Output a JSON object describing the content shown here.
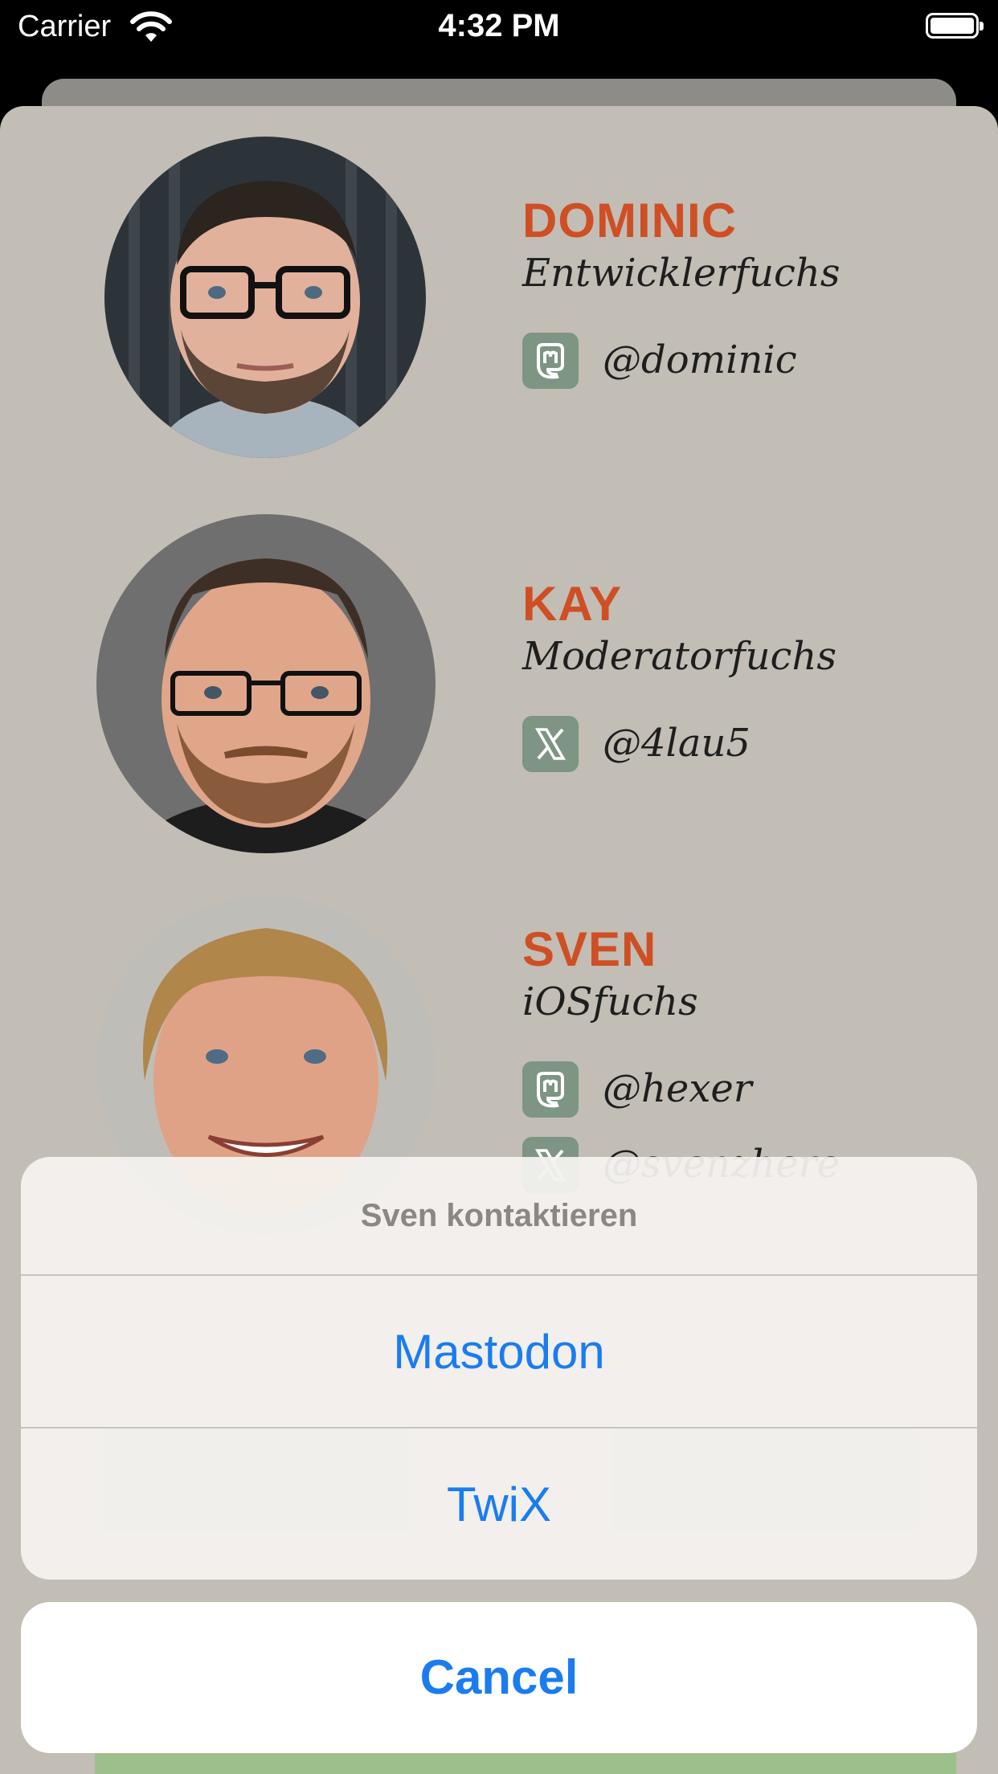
{
  "status_bar": {
    "carrier": "Carrier",
    "time": "4:32 PM"
  },
  "team": [
    {
      "name": "DOMINIC",
      "role": "Entwicklerfuchs",
      "handles": [
        {
          "network": "mastodon",
          "icon": "mastodon-icon",
          "handle": "@dominic"
        }
      ]
    },
    {
      "name": "KAY",
      "role": "Moderatorfuchs",
      "handles": [
        {
          "network": "x",
          "icon": "x-icon",
          "handle": "@4lau5"
        }
      ]
    },
    {
      "name": "SVEN",
      "role": "iOSfuchs",
      "handles": [
        {
          "network": "mastodon",
          "icon": "mastodon-icon",
          "handle": "@hexer"
        },
        {
          "network": "x",
          "icon": "x-icon",
          "handle": "@svenzhere"
        }
      ]
    }
  ],
  "action_sheet": {
    "title": "Sven kontaktieren",
    "options": [
      "Mastodon",
      "TwiX"
    ],
    "cancel": "Cancel"
  },
  "colors": {
    "name_accent": "#cf4f24",
    "action_blue": "#1a7cf0",
    "sheet_background": "#c2bdb5",
    "icon_background": "#7d9582"
  }
}
